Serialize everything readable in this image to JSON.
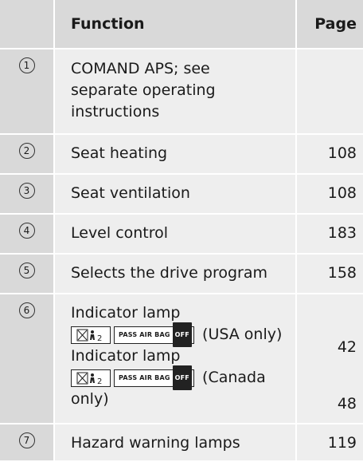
{
  "header": {
    "function": "Function",
    "page": "Page"
  },
  "rows": [
    {
      "num": "1",
      "text": "COMAND APS; see separate operating instructions",
      "page": ""
    },
    {
      "num": "2",
      "text": "Seat heating",
      "page": "108"
    },
    {
      "num": "3",
      "text": "Seat ventilation",
      "page": "108"
    },
    {
      "num": "4",
      "text": "Level control",
      "page": "183"
    },
    {
      "num": "5",
      "text": "Selects the drive program",
      "page": "158"
    },
    {
      "num": "6",
      "entries": [
        {
          "title": "Indicator lamp",
          "badge_label": "PASS AIR BAG",
          "badge_state": "OFF",
          "suffix": "(USA only)",
          "page": "42"
        },
        {
          "title": "Indicator lamp",
          "badge_label": "PASS AIR BAG",
          "badge_state": "OFF",
          "suffix": "(Canada",
          "suffix2": "only)",
          "page": "48"
        }
      ]
    },
    {
      "num": "7",
      "text": "Hazard warning lamps",
      "page": "119"
    }
  ]
}
